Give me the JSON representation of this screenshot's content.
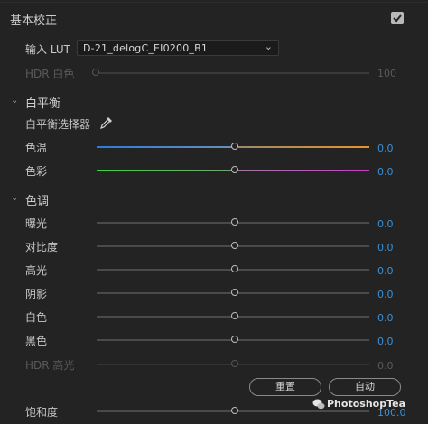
{
  "section_title": "基本校正",
  "lut": {
    "label": "输入 LUT",
    "value": "D-21_delogC_EI0200_B1"
  },
  "hdr_white": {
    "label": "HDR 白色",
    "value": "100"
  },
  "white_balance": {
    "title": "白平衡",
    "picker_label": "白平衡选择器",
    "temperature": {
      "label": "色温",
      "value": "0.0"
    },
    "tint": {
      "label": "色彩",
      "value": "0.0"
    }
  },
  "tone": {
    "title": "色调",
    "rows": [
      {
        "label": "曝光",
        "value": "0.0"
      },
      {
        "label": "对比度",
        "value": "0.0"
      },
      {
        "label": "高光",
        "value": "0.0"
      },
      {
        "label": "阴影",
        "value": "0.0"
      },
      {
        "label": "白色",
        "value": "0.0"
      },
      {
        "label": "黑色",
        "value": "0.0"
      }
    ],
    "hdr_highlight": {
      "label": "HDR 高光",
      "value": "0.0"
    },
    "reset_label": "重置",
    "auto_label": "自动"
  },
  "saturation": {
    "label": "饱和度",
    "value": "100.0"
  },
  "watermark": "PhotoshopTea",
  "colors": {
    "accent": "#3a8fd6",
    "temp_cold": "#2f7bdc",
    "temp_warm": "#e8922e",
    "tint_green": "#3fd43f",
    "tint_magenta": "#c93fc9"
  },
  "icons": [
    "chevron-down-icon",
    "eyedropper-icon",
    "checkbox-checked-icon",
    "wechat-icon"
  ]
}
